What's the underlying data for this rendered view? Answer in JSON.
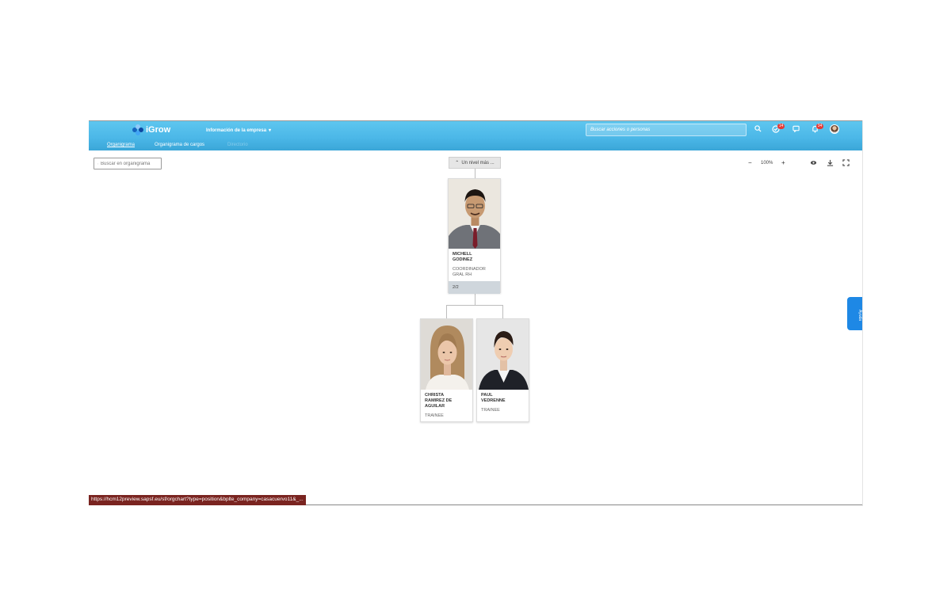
{
  "header": {
    "brand": "iGrow",
    "company_menu": "Información de la empresa",
    "search_placeholder": "Buscar acciones o personas",
    "badges": {
      "approvals": "14",
      "notifications": "34"
    }
  },
  "tabs": [
    {
      "label": "Organigrama",
      "active": true
    },
    {
      "label": "Organigrama de cargos",
      "active": false
    },
    {
      "label": "Directorio",
      "active": false
    }
  ],
  "toolbar": {
    "search_placeholder": "Buscar en organigrama",
    "up_level": "Un nivel más ...",
    "zoom": "100%",
    "zoom_out": "−",
    "zoom_in": "+"
  },
  "nodes": {
    "manager": {
      "first": "MICHELL",
      "last": "GODINEZ",
      "role_1": "COORDINADOR",
      "role_2": "GRAL RH",
      "count": "2/2"
    },
    "reports": [
      {
        "l1": "CHRISTA",
        "l2": "RAMIREZ DE",
        "l3": "AGUILAR",
        "role": "TRAINEE"
      },
      {
        "l1": "PAUL",
        "l2": "VEDRENNE",
        "role": "TRAINEE"
      }
    ]
  },
  "feedback_tab": "Ayuda",
  "status_url": "https://hcm12preview.sapsf.eu/sf/orgchart?type=position&bplte_company=casacuervo11&_...",
  "colors": {
    "header": "#4cb8e8",
    "status_bar": "#7a2420",
    "badge": "#e53935",
    "feedback": "#1e88e5"
  }
}
